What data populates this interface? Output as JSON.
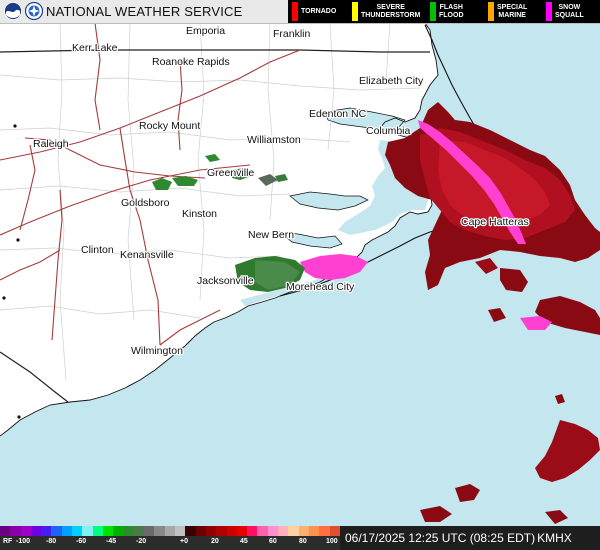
{
  "header": {
    "title": "NATIONAL WEATHER SERVICE"
  },
  "warning_legend": [
    {
      "label": "TORNADO",
      "color": "#ff0000"
    },
    {
      "label": "SEVERE\nTHUNDERSTORM",
      "color": "#ffff00"
    },
    {
      "label": "FLASH\nFLOOD",
      "color": "#00c000"
    },
    {
      "label": "SPECIAL\nMARINE",
      "color": "#ffa500"
    },
    {
      "label": "SNOW\nSQUALL",
      "color": "#ff00ff"
    }
  ],
  "cities": [
    {
      "name": "Emporia"
    },
    {
      "name": "Franklin"
    },
    {
      "name": "Kerr Lake"
    },
    {
      "name": "Roanoke Rapids"
    },
    {
      "name": "Elizabeth City"
    },
    {
      "name": "Edenton NC"
    },
    {
      "name": "Rocky Mount"
    },
    {
      "name": "Columbia"
    },
    {
      "name": "Raleigh"
    },
    {
      "name": "Williamston"
    },
    {
      "name": "Greenville"
    },
    {
      "name": "Goldsboro"
    },
    {
      "name": "Kinston"
    },
    {
      "name": "Cape Hatteras"
    },
    {
      "name": "New Bern"
    },
    {
      "name": "Clinton"
    },
    {
      "name": "Kenansville"
    },
    {
      "name": "Jacksonville"
    },
    {
      "name": "Morehead City"
    },
    {
      "name": "Wilmington"
    }
  ],
  "colorbar": {
    "label_rf": "RF",
    "ticks": [
      "-100",
      "-80",
      "-60",
      "-45",
      "-20",
      "+0",
      "20",
      "45",
      "60",
      "80",
      "100"
    ],
    "colors": [
      "#6a0080",
      "#8a00a8",
      "#a000c8",
      "#7000e0",
      "#4020f0",
      "#2060ff",
      "#00a0ff",
      "#00d0ff",
      "#80f0f0",
      "#00ff80",
      "#00e000",
      "#00b000",
      "#2d8a2d",
      "#4a7a4a",
      "#6a6a6a",
      "#888888",
      "#a8a8a8",
      "#c0c0c0",
      "#3a0000",
      "#6a0000",
      "#900000",
      "#b00000",
      "#d00000",
      "#e80000",
      "#ff1060",
      "#ff60b0",
      "#ff90d0",
      "#ffb0c0",
      "#ffd0a0",
      "#ffb070",
      "#ff9050",
      "#ff7040",
      "#e05030"
    ]
  },
  "timestamp": {
    "text": "06/17/2025 12:25 UTC (08:25 EDT)",
    "radar": "KMHX"
  },
  "colors": {
    "ocean": "#c4e6ee",
    "land": "#ffffff",
    "county_lines": "#c8c8c8",
    "state_lines": "#222222",
    "roads": "#a83a3a",
    "reflectivity_heavy": "#b01020",
    "reflectivity_mod": "#8a0a14",
    "velocity_pink": "#ff40d0",
    "ground_green": "#2f7a2f"
  }
}
